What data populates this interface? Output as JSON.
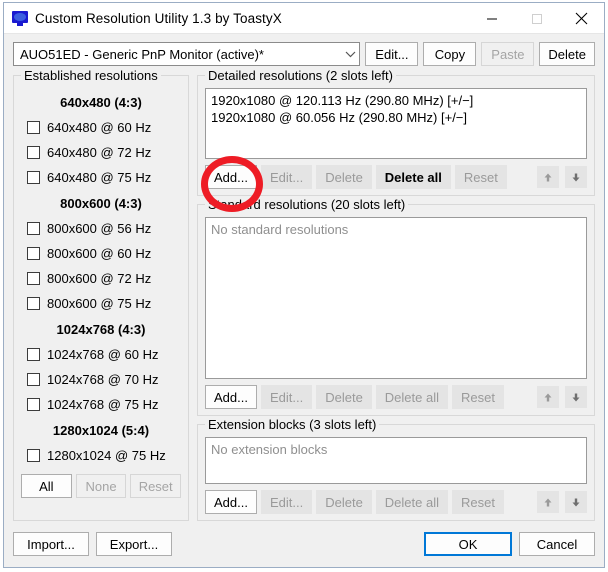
{
  "window": {
    "title": "Custom Resolution Utility 1.3 by ToastyX",
    "icon": "monitor-icon",
    "minimize_label": "minimize-icon",
    "maximize_label": "maximize-icon",
    "close_label": "close-icon"
  },
  "monitor_select": {
    "value": "AUO51ED - Generic PnP Monitor (active)*",
    "chevron": "chevron-down-icon",
    "buttons": [
      {
        "label": "Edit...",
        "enabled": true
      },
      {
        "label": "Copy",
        "enabled": true
      },
      {
        "label": "Paste",
        "enabled": false
      },
      {
        "label": "Delete",
        "enabled": true
      }
    ]
  },
  "established": {
    "legend": "Established resolutions",
    "groups": [
      {
        "heading": "640x480 (4:3)",
        "items": [
          {
            "label": "640x480 @ 60 Hz",
            "checked": false
          },
          {
            "label": "640x480 @ 72 Hz",
            "checked": false
          },
          {
            "label": "640x480 @ 75 Hz",
            "checked": false
          }
        ]
      },
      {
        "heading": "800x600 (4:3)",
        "items": [
          {
            "label": "800x600 @ 56 Hz",
            "checked": false
          },
          {
            "label": "800x600 @ 60 Hz",
            "checked": false
          },
          {
            "label": "800x600 @ 72 Hz",
            "checked": false
          },
          {
            "label": "800x600 @ 75 Hz",
            "checked": false
          }
        ]
      },
      {
        "heading": "1024x768 (4:3)",
        "items": [
          {
            "label": "1024x768 @ 60 Hz",
            "checked": false
          },
          {
            "label": "1024x768 @ 70 Hz",
            "checked": false
          },
          {
            "label": "1024x768 @ 75 Hz",
            "checked": false
          }
        ]
      },
      {
        "heading": "1280x1024 (5:4)",
        "items": [
          {
            "label": "1280x1024 @ 75 Hz",
            "checked": false
          }
        ]
      }
    ],
    "buttons": [
      {
        "label": "All",
        "enabled": true
      },
      {
        "label": "None",
        "enabled": false
      },
      {
        "label": "Reset",
        "enabled": false
      }
    ]
  },
  "detailed": {
    "legend": "Detailed resolutions (2 slots left)",
    "items": [
      "1920x1080 @ 120.113 Hz (290.80 MHz) [+/−]",
      "1920x1080 @ 60.056 Hz (290.80 MHz) [+/−]"
    ],
    "empty_text": "",
    "buttons": [
      {
        "label": "Add...",
        "state": "enabled"
      },
      {
        "label": "Edit...",
        "state": "disabled"
      },
      {
        "label": "Delete",
        "state": "disabled"
      },
      {
        "label": "Delete all",
        "state": "active"
      },
      {
        "label": "Reset",
        "state": "disabled"
      }
    ],
    "move_up": "arrow-up-icon",
    "move_down": "arrow-down-icon"
  },
  "standard": {
    "legend": "Standard resolutions (20 slots left)",
    "items": [],
    "empty_text": "No standard resolutions",
    "buttons": [
      {
        "label": "Add...",
        "state": "enabled"
      },
      {
        "label": "Edit...",
        "state": "disabled"
      },
      {
        "label": "Delete",
        "state": "disabled"
      },
      {
        "label": "Delete all",
        "state": "disabled"
      },
      {
        "label": "Reset",
        "state": "disabled"
      }
    ],
    "move_up": "arrow-up-icon",
    "move_down": "arrow-down-icon"
  },
  "extension": {
    "legend": "Extension blocks (3 slots left)",
    "items": [],
    "empty_text": "No extension blocks",
    "buttons": [
      {
        "label": "Add...",
        "state": "enabled"
      },
      {
        "label": "Edit...",
        "state": "disabled"
      },
      {
        "label": "Delete",
        "state": "disabled"
      },
      {
        "label": "Delete all",
        "state": "disabled"
      },
      {
        "label": "Reset",
        "state": "disabled"
      }
    ],
    "move_up": "arrow-up-icon",
    "move_down": "arrow-down-icon"
  },
  "footer": {
    "import_label": "Import...",
    "export_label": "Export...",
    "ok_label": "OK",
    "cancel_label": "Cancel"
  },
  "annotation": {
    "type": "highlight-circle",
    "target": "detailed-add-button",
    "color": "#ee1c25"
  },
  "colors": {
    "dialog_bg": "#f0f0f0",
    "accent": "#0078d7",
    "annotation_red": "#ee1c25",
    "disabled_text": "#a5a5a5",
    "placeholder_text": "#8f8f8f"
  }
}
